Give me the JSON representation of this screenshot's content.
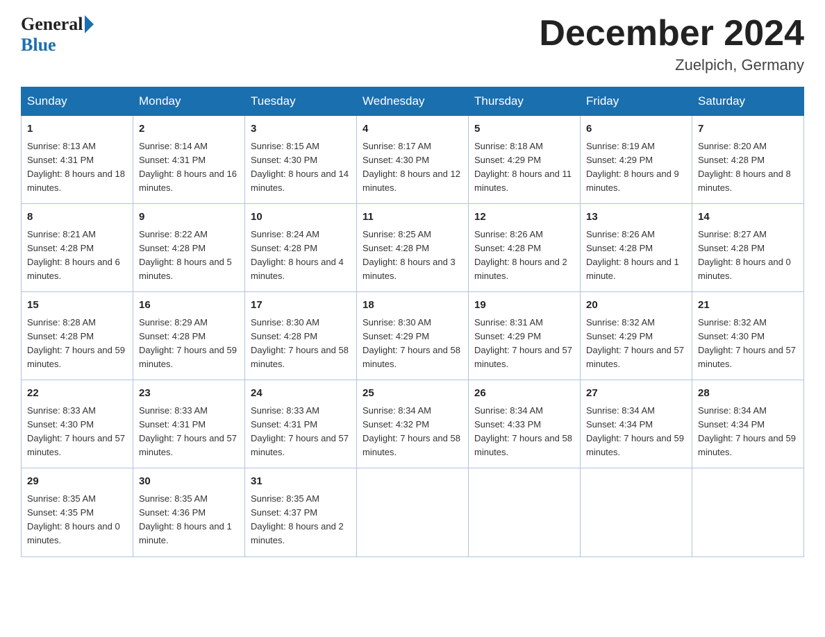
{
  "header": {
    "logo_general": "General",
    "logo_blue": "Blue",
    "month_title": "December 2024",
    "location": "Zuelpich, Germany"
  },
  "days_of_week": [
    "Sunday",
    "Monday",
    "Tuesday",
    "Wednesday",
    "Thursday",
    "Friday",
    "Saturday"
  ],
  "weeks": [
    [
      {
        "day": "1",
        "sunrise": "8:13 AM",
        "sunset": "4:31 PM",
        "daylight": "8 hours and 18 minutes."
      },
      {
        "day": "2",
        "sunrise": "8:14 AM",
        "sunset": "4:31 PM",
        "daylight": "8 hours and 16 minutes."
      },
      {
        "day": "3",
        "sunrise": "8:15 AM",
        "sunset": "4:30 PM",
        "daylight": "8 hours and 14 minutes."
      },
      {
        "day": "4",
        "sunrise": "8:17 AM",
        "sunset": "4:30 PM",
        "daylight": "8 hours and 12 minutes."
      },
      {
        "day": "5",
        "sunrise": "8:18 AM",
        "sunset": "4:29 PM",
        "daylight": "8 hours and 11 minutes."
      },
      {
        "day": "6",
        "sunrise": "8:19 AM",
        "sunset": "4:29 PM",
        "daylight": "8 hours and 9 minutes."
      },
      {
        "day": "7",
        "sunrise": "8:20 AM",
        "sunset": "4:28 PM",
        "daylight": "8 hours and 8 minutes."
      }
    ],
    [
      {
        "day": "8",
        "sunrise": "8:21 AM",
        "sunset": "4:28 PM",
        "daylight": "8 hours and 6 minutes."
      },
      {
        "day": "9",
        "sunrise": "8:22 AM",
        "sunset": "4:28 PM",
        "daylight": "8 hours and 5 minutes."
      },
      {
        "day": "10",
        "sunrise": "8:24 AM",
        "sunset": "4:28 PM",
        "daylight": "8 hours and 4 minutes."
      },
      {
        "day": "11",
        "sunrise": "8:25 AM",
        "sunset": "4:28 PM",
        "daylight": "8 hours and 3 minutes."
      },
      {
        "day": "12",
        "sunrise": "8:26 AM",
        "sunset": "4:28 PM",
        "daylight": "8 hours and 2 minutes."
      },
      {
        "day": "13",
        "sunrise": "8:26 AM",
        "sunset": "4:28 PM",
        "daylight": "8 hours and 1 minute."
      },
      {
        "day": "14",
        "sunrise": "8:27 AM",
        "sunset": "4:28 PM",
        "daylight": "8 hours and 0 minutes."
      }
    ],
    [
      {
        "day": "15",
        "sunrise": "8:28 AM",
        "sunset": "4:28 PM",
        "daylight": "7 hours and 59 minutes."
      },
      {
        "day": "16",
        "sunrise": "8:29 AM",
        "sunset": "4:28 PM",
        "daylight": "7 hours and 59 minutes."
      },
      {
        "day": "17",
        "sunrise": "8:30 AM",
        "sunset": "4:28 PM",
        "daylight": "7 hours and 58 minutes."
      },
      {
        "day": "18",
        "sunrise": "8:30 AM",
        "sunset": "4:29 PM",
        "daylight": "7 hours and 58 minutes."
      },
      {
        "day": "19",
        "sunrise": "8:31 AM",
        "sunset": "4:29 PM",
        "daylight": "7 hours and 57 minutes."
      },
      {
        "day": "20",
        "sunrise": "8:32 AM",
        "sunset": "4:29 PM",
        "daylight": "7 hours and 57 minutes."
      },
      {
        "day": "21",
        "sunrise": "8:32 AM",
        "sunset": "4:30 PM",
        "daylight": "7 hours and 57 minutes."
      }
    ],
    [
      {
        "day": "22",
        "sunrise": "8:33 AM",
        "sunset": "4:30 PM",
        "daylight": "7 hours and 57 minutes."
      },
      {
        "day": "23",
        "sunrise": "8:33 AM",
        "sunset": "4:31 PM",
        "daylight": "7 hours and 57 minutes."
      },
      {
        "day": "24",
        "sunrise": "8:33 AM",
        "sunset": "4:31 PM",
        "daylight": "7 hours and 57 minutes."
      },
      {
        "day": "25",
        "sunrise": "8:34 AM",
        "sunset": "4:32 PM",
        "daylight": "7 hours and 58 minutes."
      },
      {
        "day": "26",
        "sunrise": "8:34 AM",
        "sunset": "4:33 PM",
        "daylight": "7 hours and 58 minutes."
      },
      {
        "day": "27",
        "sunrise": "8:34 AM",
        "sunset": "4:34 PM",
        "daylight": "7 hours and 59 minutes."
      },
      {
        "day": "28",
        "sunrise": "8:34 AM",
        "sunset": "4:34 PM",
        "daylight": "7 hours and 59 minutes."
      }
    ],
    [
      {
        "day": "29",
        "sunrise": "8:35 AM",
        "sunset": "4:35 PM",
        "daylight": "8 hours and 0 minutes."
      },
      {
        "day": "30",
        "sunrise": "8:35 AM",
        "sunset": "4:36 PM",
        "daylight": "8 hours and 1 minute."
      },
      {
        "day": "31",
        "sunrise": "8:35 AM",
        "sunset": "4:37 PM",
        "daylight": "8 hours and 2 minutes."
      },
      null,
      null,
      null,
      null
    ]
  ],
  "labels": {
    "sunrise_prefix": "Sunrise: ",
    "sunset_prefix": "Sunset: ",
    "daylight_prefix": "Daylight: "
  }
}
